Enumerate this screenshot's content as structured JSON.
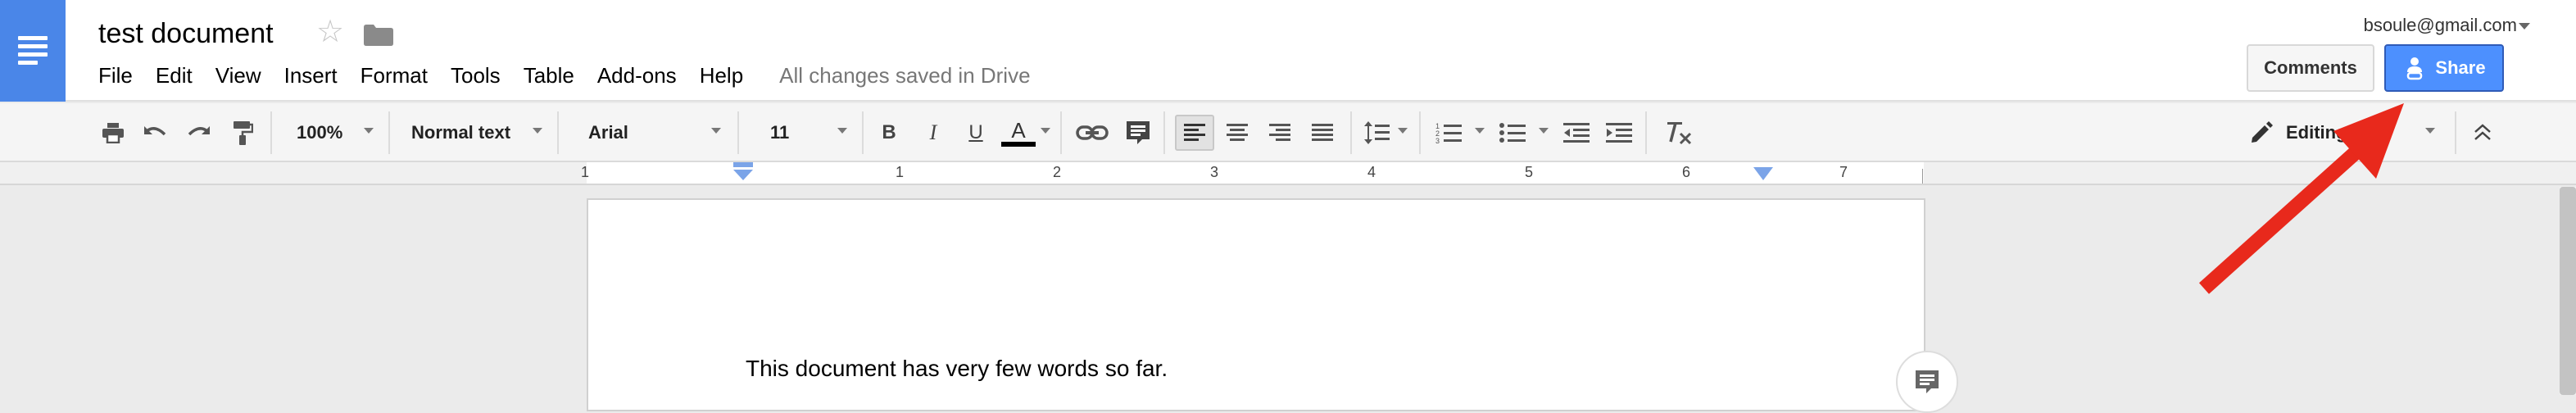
{
  "document": {
    "title": "test document",
    "save_status": "All changes saved in Drive",
    "body_text": "This document has very few words so far."
  },
  "menu": [
    "File",
    "Edit",
    "View",
    "Insert",
    "Format",
    "Tools",
    "Table",
    "Add-ons",
    "Help"
  ],
  "account": {
    "email": "bsoule@gmail.com"
  },
  "buttons": {
    "comments": "Comments",
    "share": "Share"
  },
  "toolbar": {
    "zoom": "100%",
    "style": "Normal text",
    "font": "Arial",
    "font_size": "11",
    "bold": "B",
    "italic": "I",
    "underline": "U",
    "text_color": "A",
    "mode": "Editing"
  },
  "ruler": {
    "numbers": [
      "1",
      "1",
      "2",
      "3",
      "4",
      "5",
      "6",
      "7"
    ]
  },
  "colors": {
    "accent": "#4a86e8",
    "share": "#4d90fe",
    "annotation_arrow": "#e8291c"
  },
  "icons": [
    "docs-logo-icon",
    "star-icon",
    "folder-icon",
    "print-icon",
    "undo-icon",
    "redo-icon",
    "paint-format-icon",
    "link-icon",
    "comment-icon",
    "align-left-icon",
    "align-center-icon",
    "align-right-icon",
    "justify-icon",
    "line-spacing-icon",
    "numbered-list-icon",
    "bulleted-list-icon",
    "decrease-indent-icon",
    "increase-indent-icon",
    "clear-formatting-icon",
    "pencil-icon",
    "collapse-icon"
  ]
}
